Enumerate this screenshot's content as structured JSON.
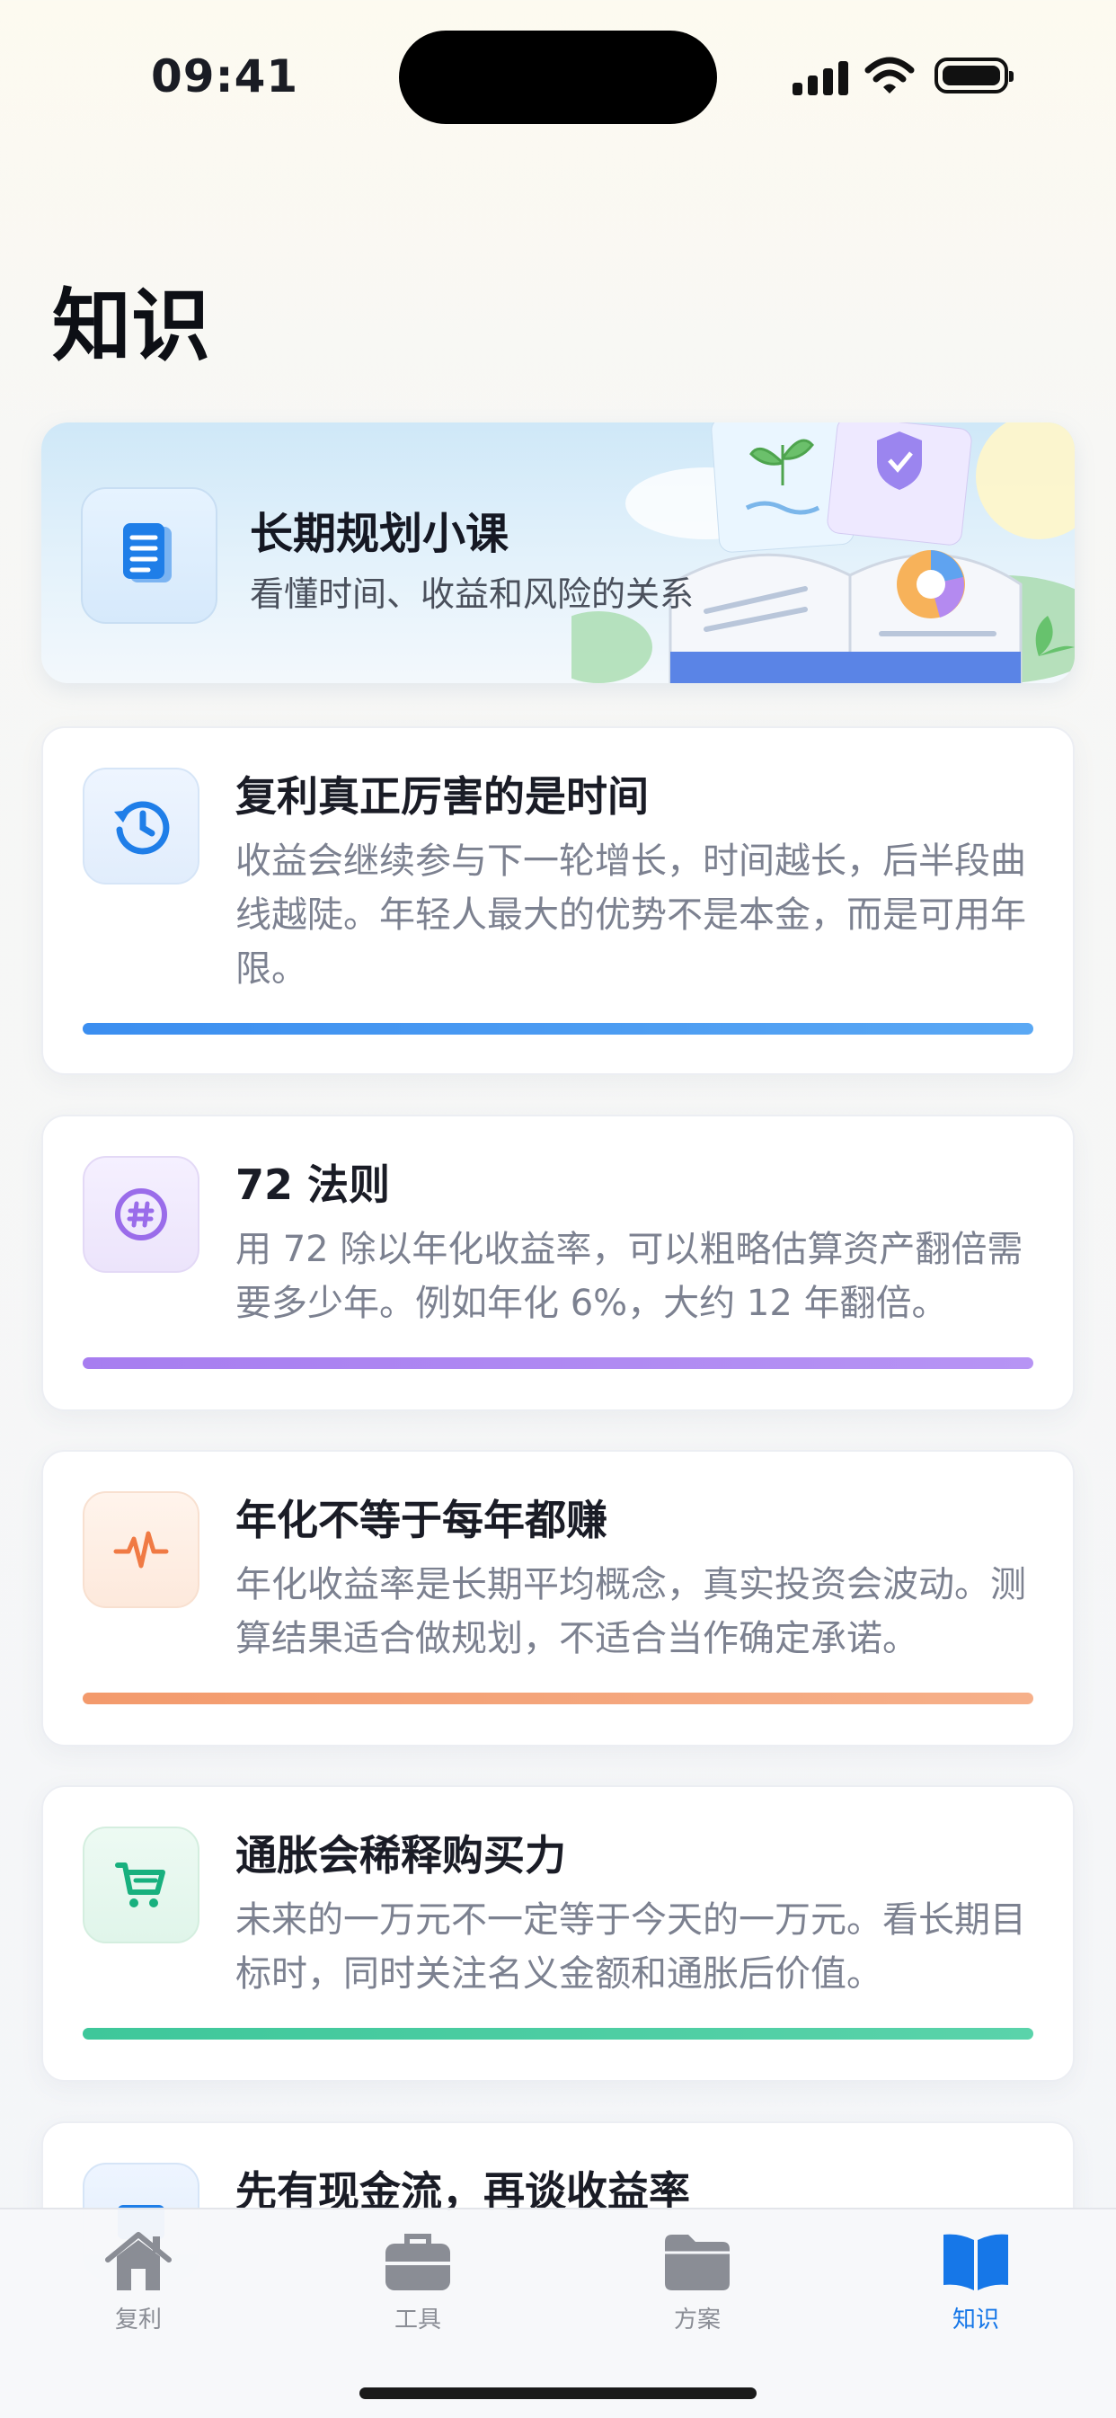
{
  "status_bar": {
    "time": "09:41"
  },
  "page": {
    "title": "知识"
  },
  "banner": {
    "title": "长期规划小课",
    "subtitle": "看懂时间、收益和风险的关系",
    "icon": "document-icon"
  },
  "cards": [
    {
      "title": "复利真正厉害的是时间",
      "body": "收益会继续参与下一轮增长，时间越长，后半段曲线越陡。年轻人最大的优势不是本金，而是可用年限。",
      "icon": "history-clock-icon",
      "accent": "#3b8ef0"
    },
    {
      "title": "72 法则",
      "body": "用 72 除以年化收益率，可以粗略估算资产翻倍需要多少年。例如年化 6%，大约 12 年翻倍。",
      "icon": "hash-icon",
      "accent": "#a77df0"
    },
    {
      "title": "年化不等于每年都赚",
      "body": "年化收益率是长期平均概念，真实投资会波动。测算结果适合做规划，不适合当作确定承诺。",
      "icon": "pulse-icon",
      "accent": "#f39a6c"
    },
    {
      "title": "通胀会稀释购买力",
      "body": "未来的一万元不一定等于今天的一万元。看长期目标时，同时关注名义金额和通胀后价值。",
      "icon": "cart-icon",
      "accent": "#3ec79a"
    },
    {
      "title": "先有现金流，再谈收益率",
      "icon": "wallet-icon"
    }
  ],
  "tab_bar": {
    "items": [
      {
        "label": "复利",
        "icon": "home-icon"
      },
      {
        "label": "工具",
        "icon": "briefcase-icon"
      },
      {
        "label": "方案",
        "icon": "folder-icon"
      },
      {
        "label": "知识",
        "icon": "book-icon",
        "active": true
      }
    ]
  },
  "colors": {
    "accent": "#1677e8",
    "inactive": "#8a8d95"
  }
}
